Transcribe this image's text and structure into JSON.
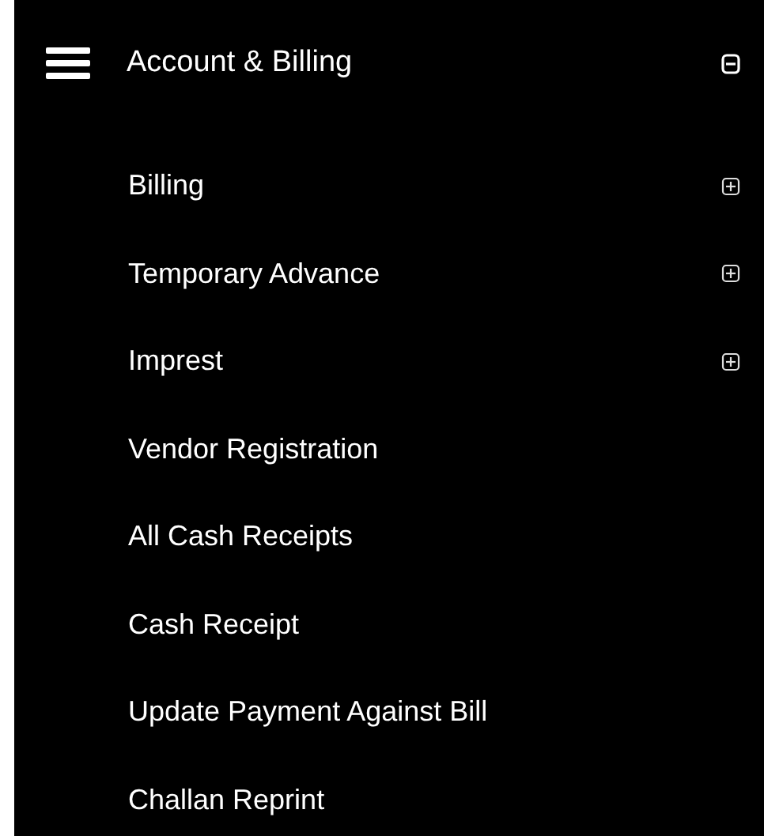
{
  "menu": {
    "title": "Account & Billing",
    "expanded": true,
    "items": [
      {
        "label": "Billing",
        "kind": "group",
        "expanded": false
      },
      {
        "label": "Temporary Advance",
        "kind": "group",
        "expanded": false
      },
      {
        "label": "Imprest",
        "kind": "group",
        "expanded": false
      },
      {
        "label": "Vendor Registration",
        "kind": "link"
      },
      {
        "label": "All Cash Receipts",
        "kind": "link"
      },
      {
        "label": "Cash Receipt",
        "kind": "link"
      },
      {
        "label": "Update Payment Against Bill",
        "kind": "link"
      },
      {
        "label": "Challan Reprint",
        "kind": "link"
      }
    ]
  }
}
